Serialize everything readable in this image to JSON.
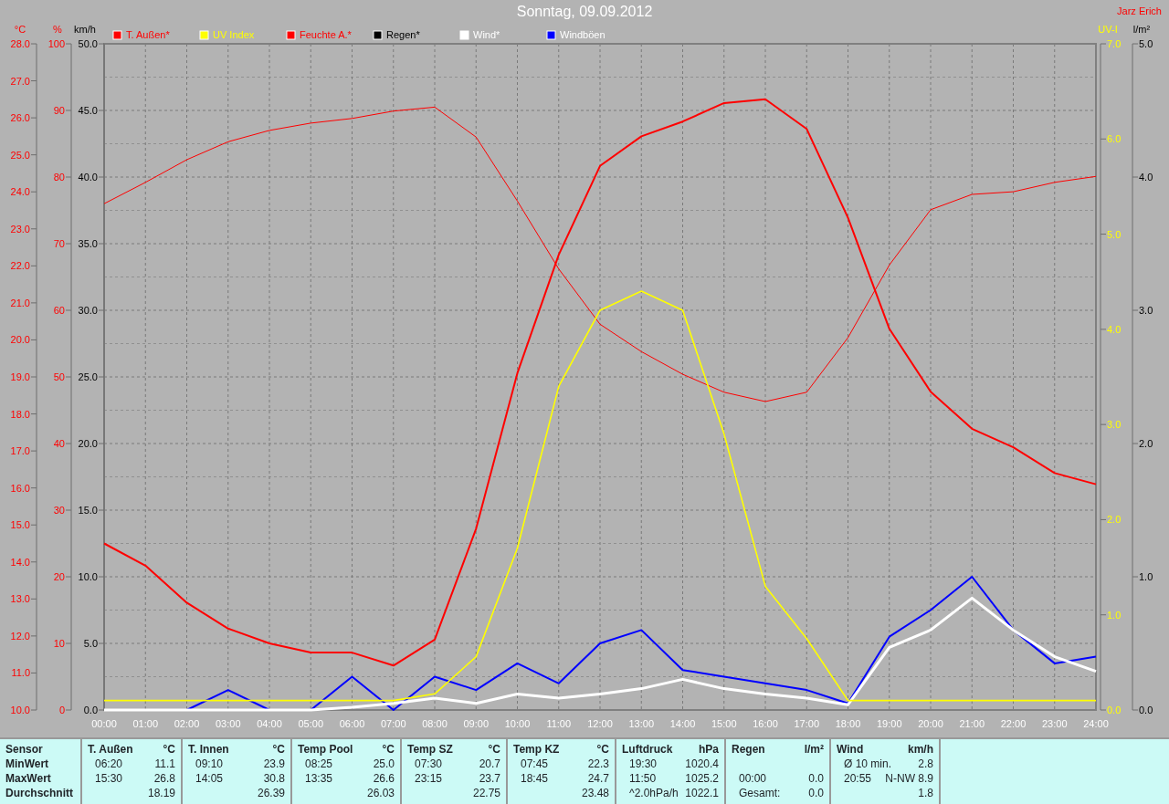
{
  "title": "Sonntag, 09.09.2012",
  "author": "Jarz Erich",
  "charts": [
    {
      "chart_data": {
        "type": "line",
        "grid": true,
        "legend": "top",
        "x": [
          0,
          1,
          2,
          3,
          4,
          5,
          6,
          7,
          8,
          9,
          10,
          11,
          12,
          13,
          14,
          15,
          16,
          17,
          18,
          19,
          20,
          21,
          22,
          23,
          24
        ],
        "xlim": [
          0,
          24
        ],
        "xticks": [
          {
            "value": 0,
            "label": "00:00"
          },
          {
            "value": 1,
            "label": "01:00"
          },
          {
            "value": 2,
            "label": "02:00"
          },
          {
            "value": 3,
            "label": "03:00"
          },
          {
            "value": 4,
            "label": "04:00"
          },
          {
            "value": 5,
            "label": "05:00"
          },
          {
            "value": 6,
            "label": "06:00"
          },
          {
            "value": 7,
            "label": "07:00"
          },
          {
            "value": 8,
            "label": "08:00"
          },
          {
            "value": 9,
            "label": "09:00"
          },
          {
            "value": 10,
            "label": "10:00"
          },
          {
            "value": 11,
            "label": "11:00"
          },
          {
            "value": 12,
            "label": "12:00"
          },
          {
            "value": 13,
            "label": "13:00"
          },
          {
            "value": 14,
            "label": "14:00"
          },
          {
            "value": 15,
            "label": "15:00"
          },
          {
            "value": 16,
            "label": "16:00"
          },
          {
            "value": 17,
            "label": "17:00"
          },
          {
            "value": 18,
            "label": "18:00"
          },
          {
            "value": 19,
            "label": "19:00"
          },
          {
            "value": 20,
            "label": "20:00"
          },
          {
            "value": 21,
            "label": "21:00"
          },
          {
            "value": 22,
            "label": "22:00"
          },
          {
            "value": 23,
            "label": "23:00"
          },
          {
            "value": 24,
            "label": "24:00"
          }
        ],
        "ylabel": "km/h",
        "ylim": [
          0,
          50
        ],
        "yticks": [
          {
            "value": 50,
            "label": "50.0"
          },
          {
            "value": 45,
            "label": "45.0"
          },
          {
            "value": 40,
            "label": "40.0"
          },
          {
            "value": 35,
            "label": "35.0"
          },
          {
            "value": 30,
            "label": "30.0"
          },
          {
            "value": 25,
            "label": "25.0"
          },
          {
            "value": 20,
            "label": "20.0"
          },
          {
            "value": 15,
            "label": "15.0"
          },
          {
            "value": 10,
            "label": "10.0"
          },
          {
            "value": 5,
            "label": "5.0"
          },
          {
            "value": 0,
            "label": "0.0"
          }
        ],
        "y2label": "°C",
        "y2lim": [
          10,
          28
        ],
        "y2ticks": [
          {
            "value": 28,
            "label": "28.0"
          },
          {
            "value": 27,
            "label": "27.0"
          },
          {
            "value": 26,
            "label": "26.0"
          },
          {
            "value": 25,
            "label": "25.0"
          },
          {
            "value": 24,
            "label": "24.0"
          },
          {
            "value": 23,
            "label": "23.0"
          },
          {
            "value": 22,
            "label": "22.0"
          },
          {
            "value": 21,
            "label": "21.0"
          },
          {
            "value": 20,
            "label": "20.0"
          },
          {
            "value": 19,
            "label": "19.0"
          },
          {
            "value": 18,
            "label": "18.0"
          },
          {
            "value": 17,
            "label": "17.0"
          },
          {
            "value": 16,
            "label": "16.0"
          },
          {
            "value": 15,
            "label": "15.0"
          },
          {
            "value": 14,
            "label": "14.0"
          },
          {
            "value": 13,
            "label": "13.0"
          },
          {
            "value": 12,
            "label": "12.0"
          },
          {
            "value": 11,
            "label": "11.0"
          },
          {
            "value": 10,
            "label": "10.0"
          }
        ],
        "y3label": "%",
        "y3lim": [
          0,
          100
        ],
        "y3ticks": [
          {
            "value": 100,
            "label": "100"
          },
          {
            "value": 90,
            "label": "90"
          },
          {
            "value": 80,
            "label": "80"
          },
          {
            "value": 70,
            "label": "70"
          },
          {
            "value": 60,
            "label": "60"
          },
          {
            "value": 50,
            "label": "50"
          },
          {
            "value": 40,
            "label": "40"
          },
          {
            "value": 30,
            "label": "30"
          },
          {
            "value": 20,
            "label": "20"
          },
          {
            "value": 10,
            "label": "10"
          },
          {
            "value": 0,
            "label": "0"
          }
        ],
        "series": [
          {
            "name": "T. Außen*",
            "color": "#ff0000",
            "axis": "y2",
            "values": [
              14.5,
              13.9,
              12.9,
              12.2,
              11.8,
              11.55,
              11.55,
              11.2,
              11.9,
              14.9,
              19.1,
              22.3,
              24.7,
              25.5,
              25.9,
              26.4,
              26.5,
              25.7,
              23.3,
              20.3,
              18.6,
              17.6,
              17.1,
              16.4,
              16.1
            ]
          },
          {
            "name": "Feuchte A.*",
            "color": "#ff0000",
            "axis": "y3",
            "values": [
              76,
              79.2,
              82.6,
              85.3,
              87,
              88.1,
              88.8,
              89.9,
              90.5,
              86,
              76.4,
              66.2,
              57.9,
              53.8,
              50.4,
              47.7,
              46.3,
              47.7,
              55.9,
              66.8,
              75.1,
              77.4,
              77.8,
              79.2,
              80.1
            ]
          },
          {
            "name": "Wind*",
            "color": "#ffffff",
            "values": [
              0,
              0,
              0,
              0,
              0,
              0,
              0.2,
              0.5,
              0.9,
              0.5,
              1.2,
              0.9,
              1.2,
              1.6,
              2.3,
              1.6,
              1.2,
              0.9,
              0.4,
              4.7,
              6.0,
              8.4,
              6.0,
              4.0,
              2.9
            ]
          },
          {
            "name": "Windböen",
            "color": "#0000ff",
            "values": [
              0,
              0,
              0,
              1.5,
              0,
              0,
              2.5,
              0,
              2.5,
              1.5,
              3.5,
              2,
              5,
              6,
              3,
              2.5,
              2,
              1.5,
              0.5,
              5.5,
              7.5,
              10,
              6,
              3.5,
              4
            ]
          }
        ]
      }
    },
    {
      "chart_data": {
        "type": "line",
        "x": [
          0,
          1,
          2,
          3,
          4,
          5,
          6,
          7,
          8,
          9,
          10,
          11,
          12,
          13,
          14,
          15,
          16,
          17,
          18,
          19,
          20,
          21,
          22,
          23,
          24
        ],
        "xlim": [
          0,
          24
        ],
        "legend": "top",
        "ylabel": "UV-I",
        "ylim": [
          0,
          7
        ],
        "yticks": [
          {
            "value": 7,
            "label": "7.0"
          },
          {
            "value": 6,
            "label": "6.0"
          },
          {
            "value": 5,
            "label": "5.0"
          },
          {
            "value": 4,
            "label": "4.0"
          },
          {
            "value": 3,
            "label": "3.0"
          },
          {
            "value": 2,
            "label": "2.0"
          },
          {
            "value": 1,
            "label": "1.0"
          },
          {
            "value": 0,
            "label": "0.0"
          }
        ],
        "y2label": "l/m²",
        "y2lim": [
          0,
          5
        ],
        "y2ticks": [
          {
            "value": 5,
            "label": "5.0"
          },
          {
            "value": 4,
            "label": "4.0"
          },
          {
            "value": 3,
            "label": "3.0"
          },
          {
            "value": 2,
            "label": "2.0"
          },
          {
            "value": 1,
            "label": "1.0"
          },
          {
            "value": 0,
            "label": "0.0"
          }
        ],
        "series": [
          {
            "name": "UV Index",
            "color": "#ffff00",
            "values": [
              0.1,
              0.1,
              0.1,
              0.1,
              0.1,
              0.1,
              0.1,
              0.1,
              0.17,
              0.56,
              1.7,
              3.4,
              4.2,
              4.4,
              4.2,
              2.9,
              1.3,
              0.75,
              0.1,
              0.1,
              0.1,
              0.1,
              0.1,
              0.1,
              0.1
            ]
          },
          {
            "name": "Regen*",
            "color": "#000000",
            "axis": "y2",
            "values": [
              null,
              null,
              null,
              null,
              null,
              null,
              null,
              null,
              null,
              null,
              null,
              null,
              null,
              null,
              null,
              null,
              null,
              null,
              null,
              null,
              null,
              null,
              null,
              null,
              null
            ]
          }
        ]
      }
    }
  ],
  "stats": {
    "row_labels": [
      "Sensor",
      "MinWert",
      "MaxWert",
      "Durchschnitt"
    ],
    "columns": [
      {
        "name": "T. Außen",
        "unit": "°C",
        "rows": [
          {
            "label": "06:20",
            "value": "11.1"
          },
          {
            "label": "15:30",
            "value": "26.8"
          },
          {
            "value": "18.19"
          }
        ]
      },
      {
        "name": "T. Innen",
        "unit": "°C",
        "rows": [
          {
            "label": "09:10",
            "value": "23.9"
          },
          {
            "label": "14:05",
            "value": "30.8"
          },
          {
            "value": "26.39"
          }
        ]
      },
      {
        "name": "Temp Pool",
        "unit": "°C",
        "rows": [
          {
            "label": "08:25",
            "value": "25.0"
          },
          {
            "label": "13:35",
            "value": "26.6"
          },
          {
            "value": "26.03"
          }
        ]
      },
      {
        "name": "Temp SZ",
        "unit": "°C",
        "rows": [
          {
            "label": "07:30",
            "value": "20.7"
          },
          {
            "label": "23:15",
            "value": "23.7"
          },
          {
            "value": "22.75"
          }
        ]
      },
      {
        "name": "Temp KZ",
        "unit": "°C",
        "rows": [
          {
            "label": "07:45",
            "value": "22.3"
          },
          {
            "label": "18:45",
            "value": "24.7"
          },
          {
            "value": "23.48"
          }
        ]
      },
      {
        "name": "Luftdruck",
        "unit": "hPa",
        "rows": [
          {
            "label": "19:30",
            "value": "1020.4"
          },
          {
            "label": "11:50",
            "value": "1025.2"
          },
          {
            "label": "^2.0hPa/h",
            "value": "1022.1"
          }
        ]
      },
      {
        "name": "Regen",
        "unit": "l/m²",
        "rows": [
          {},
          {
            "label": "00:00",
            "value": "0.0"
          },
          {
            "label": "Gesamt:",
            "value": "0.0"
          }
        ]
      },
      {
        "name": "Wind",
        "unit": "km/h",
        "rows": [
          {
            "label": "Ø 10 min.",
            "value": "2.8"
          },
          {
            "label": "20:55",
            "value": "N-NW 8.9"
          },
          {
            "value": "1.8"
          }
        ]
      }
    ]
  }
}
